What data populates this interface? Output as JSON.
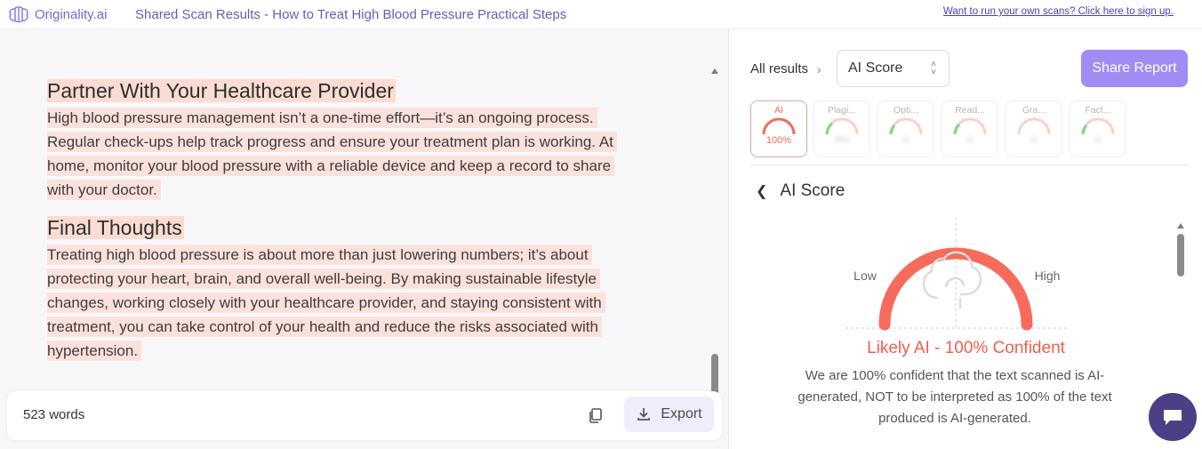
{
  "header": {
    "brand": "Originality.ai",
    "title": "Shared Scan Results - How to Treat High Blood Pressure Practical Steps",
    "signup_link": "Want to run your own scans? Click here to sign up."
  },
  "document": {
    "sections": [
      {
        "heading": "Partner With Your Healthcare Provider",
        "paragraph": "High blood pressure management isn’t a one-time effort—it’s an ongoing process. Regular check-ups help track progress and ensure your treatment plan is working. At home, monitor your blood pressure with a reliable device and keep a record to share with your doctor."
      },
      {
        "heading": "Final Thoughts",
        "paragraph": "Treating high blood pressure is about more than just lowering numbers; it’s about protecting your heart, brain, and overall well-being. By making sustainable lifestyle changes, working closely with your healthcare provider, and staying consistent with treatment, you can take control of your health and reduce the risks associated with hypertension."
      }
    ],
    "highlight_color": "#fbe1dc"
  },
  "footer": {
    "word_count": "523 words",
    "export_label": "Export"
  },
  "results": {
    "breadcrumb": "All results",
    "selected": "AI Score",
    "share_label": "Share Report",
    "tabs": [
      {
        "label": "AI",
        "value": "100%"
      },
      {
        "label": "Plagi...",
        "value": "0%"
      },
      {
        "label": "Opti...",
        "value": "0"
      },
      {
        "label": "Read...",
        "value": "0"
      },
      {
        "label": "Gra...",
        "value": "0"
      },
      {
        "label": "Fact...",
        "value": "0"
      }
    ],
    "section_title": "AI Score",
    "gauge": {
      "low_label": "Low",
      "high_label": "High",
      "score_percent": 100,
      "color": "#f76b5c"
    },
    "verdict": "Likely AI - 100% Confident",
    "explanation": "We are 100% confident that the text scanned is AI-generated, NOT to be interpreted as 100% of the text produced is AI-generated."
  },
  "icons": {
    "logo": "brain-logo-icon",
    "copy": "copy-icon",
    "export": "download-icon",
    "chat": "chat-icon"
  }
}
